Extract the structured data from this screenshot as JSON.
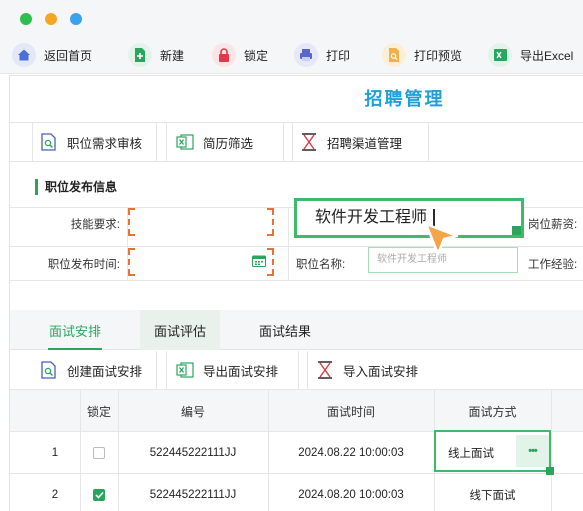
{
  "window": {
    "dots": [
      "#2fbf4e",
      "#f5a623",
      "#3aa3f0"
    ]
  },
  "toolbar": {
    "home": "返回首页",
    "new": "新建",
    "lock": "锁定",
    "print": "打印",
    "print_preview": "打印预览",
    "export_excel": "导出Excel"
  },
  "page": {
    "title": "招聘管理"
  },
  "actions": {
    "review": "职位需求审核",
    "resume": "简历筛选",
    "channel": "招聘渠道管理"
  },
  "form": {
    "section": "职位发布信息",
    "skill_label": "技能要求:",
    "time_label": "职位发布时间:",
    "position_input_value": "软件开发工程师",
    "salary_label": "岗位薪资:",
    "name_label": "职位名称:",
    "name_placeholder": "软件开发工程师",
    "experience_label": "工作经验:"
  },
  "tabs": [
    "面试安排",
    "面试评估",
    "面试结果"
  ],
  "interview_actions": {
    "create": "创建面试安排",
    "export": "导出面试安排",
    "import": "导入面试安排"
  },
  "table": {
    "headers": [
      "锁定",
      "编号",
      "面试时间",
      "面试方式"
    ],
    "rows": [
      {
        "index": "1",
        "locked": false,
        "id": "522445222111JJ",
        "time": "2024.08.22 10:00:03",
        "mode": "线上面试",
        "more": "•••"
      },
      {
        "index": "2",
        "locked": true,
        "id": "522445222111JJ",
        "time": "2024.08.20 10:00:03",
        "mode": "线下面试"
      }
    ]
  },
  "colors": {
    "accent": "#2aa55e",
    "title": "#1f9fd8",
    "orange": "#e8703a",
    "cursor": "#f5a44a"
  }
}
